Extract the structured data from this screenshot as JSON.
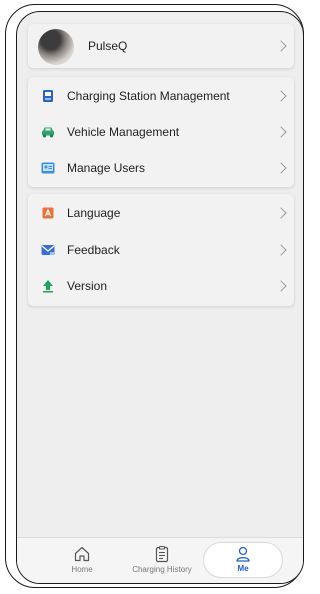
{
  "profile": {
    "name": "PulseQ"
  },
  "menu_group_1": [
    {
      "label": "Charging Station Management",
      "icon": "charging-station-icon"
    },
    {
      "label": "Vehicle Management",
      "icon": "car-icon"
    },
    {
      "label": "Manage Users",
      "icon": "users-icon"
    }
  ],
  "menu_group_2": [
    {
      "label": "Language",
      "icon": "language-icon"
    },
    {
      "label": "Feedback",
      "icon": "feedback-icon"
    },
    {
      "label": "Version",
      "icon": "version-icon"
    }
  ],
  "bottom_nav": [
    {
      "label": "Home",
      "icon": "home-icon"
    },
    {
      "label": "Charging History",
      "icon": "clipboard-icon"
    },
    {
      "label": "Me",
      "icon": "user-icon",
      "active": true
    }
  ],
  "colors": {
    "accent": "#1f5fc4",
    "charging_icon": "#2a63c6",
    "vehicle_icon": "#2fa36b",
    "users_icon": "#3d8fd6",
    "language_icon": "#e8743b",
    "feedback_icon": "#3b6fd6",
    "version_icon": "#23a35a"
  }
}
